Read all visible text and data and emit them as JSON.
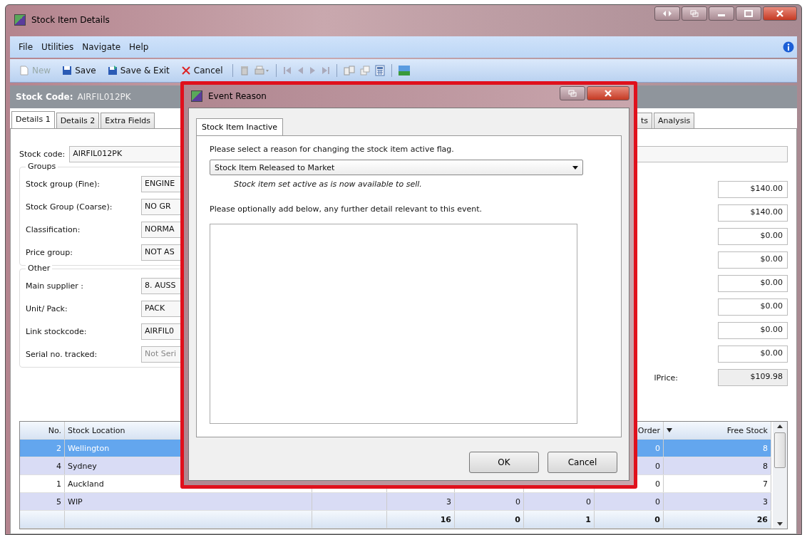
{
  "window": {
    "title": "Stock Item Details"
  },
  "menu": [
    "File",
    "Utilities",
    "Navigate",
    "Help"
  ],
  "toolbar": [
    {
      "label": "New",
      "disabled": true
    },
    {
      "label": "Save",
      "disabled": false
    },
    {
      "label": "Save & Exit",
      "disabled": false
    },
    {
      "label": "Cancel",
      "disabled": false
    }
  ],
  "header": {
    "label": "Stock Code:",
    "value": "AIRFIL012PK"
  },
  "tabs_left": [
    {
      "label": "Details 1",
      "selected": true
    },
    {
      "label": "Details 2",
      "selected": false
    },
    {
      "label": "Extra Fields",
      "selected": false
    }
  ],
  "tabs_right": [
    {
      "label": "ts",
      "selected": false
    },
    {
      "label": "Analysis",
      "selected": false
    }
  ],
  "stock_code": {
    "label": "Stock code:",
    "value": "AIRFIL012PK"
  },
  "groups": {
    "title": "Groups",
    "fields": [
      {
        "label": "Stock group (Fine):",
        "value": "ENGINE"
      },
      {
        "label": "Stock Group (Coarse):",
        "value": "NO GR"
      },
      {
        "label": "Classification:",
        "value": "NORMA"
      },
      {
        "label": "Price group:",
        "value": "NOT AS"
      }
    ]
  },
  "other": {
    "title": "Other",
    "fields": [
      {
        "label": "Main supplier :",
        "value": "8. AUSS"
      },
      {
        "label": "Unit/ Pack:",
        "value": "PACK"
      },
      {
        "label": "Link stockcode:",
        "value": "AIRFIL0"
      },
      {
        "label": "Serial no. tracked:",
        "value": "Not Seri",
        "disabled": true
      }
    ]
  },
  "prices": [
    "$140.00",
    "$140.00",
    "$0.00",
    "$0.00",
    "$0.00",
    "$0.00",
    "$0.00",
    "$0.00"
  ],
  "sell_price": {
    "label": "lPrice:",
    "value": "$109.98"
  },
  "table": {
    "columns": {
      "no": "No.",
      "location": "Stock Location",
      "order": "Order",
      "free_stock": "Free Stock"
    },
    "rows": [
      {
        "no": "2",
        "location": "Wellington",
        "order": "0",
        "free_stock": "8",
        "selected": true
      },
      {
        "no": "4",
        "location": "Sydney",
        "order": "0",
        "free_stock": "8",
        "selected": false
      },
      {
        "no": "1",
        "location": "Auckland",
        "order": "0",
        "free_stock": "7",
        "selected": false
      },
      {
        "no": "5",
        "location": "WIP",
        "column_3": "3",
        "column_4": "0",
        "column_5": "0",
        "order": "0",
        "free_stock": "3",
        "selected": false
      }
    ],
    "totals": {
      "column_3": "16",
      "column_4": "0",
      "column_5": "1",
      "order": "0",
      "free_stock": "26"
    }
  },
  "dialog": {
    "title": "Event Reason",
    "tab": {
      "label": "Stock Item Inactive",
      "selected": true
    },
    "prompt": "Please select a reason for changing the stock item active flag.",
    "reason": "Stock Item Released to Market",
    "note": "Stock item set active as is now available to sell.",
    "detail_prompt": "Please optionally add below, any further detail relevant to this event.",
    "buttons": [
      "OK",
      "Cancel"
    ]
  }
}
